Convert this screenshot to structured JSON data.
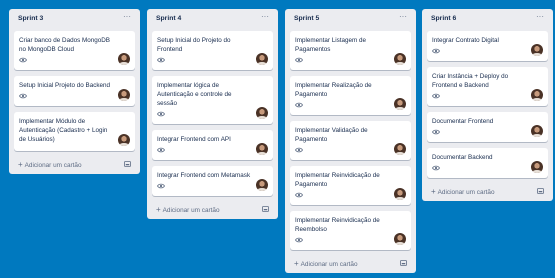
{
  "colors": {
    "board": "#0079bf",
    "list": "#ebecf0",
    "card": "#ffffff",
    "text": "#172b4d",
    "muted": "#5e6c84"
  },
  "lists": [
    {
      "title": "Sprint 3",
      "menu": "···",
      "add_label": "Adicionar um cartão",
      "cards": [
        {
          "title": "Criar banco de Dados MongoDB no MongoDB Cloud",
          "watch": true,
          "avatar": true
        },
        {
          "title": "Setup Inicial Projeto do Backend",
          "watch": true,
          "avatar": true
        },
        {
          "title": "Implementar Módulo de Autenticação (Cadastro + Login de Usuários)",
          "watch": false,
          "avatar": true
        }
      ]
    },
    {
      "title": "Sprint 4",
      "menu": "···",
      "add_label": "Adicionar um cartão",
      "cards": [
        {
          "title": "Setup Inicial do Projeto do Frontend",
          "watch": true,
          "avatar": true
        },
        {
          "title": "Implementar lógica de Autenticação e controle de sessão",
          "watch": true,
          "avatar": true
        },
        {
          "title": "Integrar Frontend com API",
          "watch": true,
          "avatar": true
        },
        {
          "title": "Integrar Frontend com Metamask",
          "watch": true,
          "avatar": true
        }
      ]
    },
    {
      "title": "Sprint 5",
      "menu": "···",
      "add_label": "Adicionar um cartão",
      "cards": [
        {
          "title": "Implementar Listagem de Pagamentos",
          "watch": true,
          "avatar": true
        },
        {
          "title": "Implementar Realização de Pagamento",
          "watch": true,
          "avatar": true
        },
        {
          "title": "Implementar Validação de Pagamento",
          "watch": true,
          "avatar": true
        },
        {
          "title": "Implementar Reinvidicação de Pagamento",
          "watch": true,
          "avatar": true
        },
        {
          "title": "Implementar Reinvidicação de Reembolso",
          "watch": true,
          "avatar": true
        }
      ]
    },
    {
      "title": "Sprint 6",
      "menu": "···",
      "add_label": "Adicionar um cartão",
      "cards": [
        {
          "title": "Integrar Contrato Digital",
          "watch": true,
          "avatar": true
        },
        {
          "title": "Criar Instância + Deploy do Frontend e Backend",
          "watch": true,
          "avatar": true
        },
        {
          "title": "Documentar Frontend",
          "watch": true,
          "avatar": true
        },
        {
          "title": "Documentar Backend",
          "watch": true,
          "avatar": true
        }
      ]
    }
  ]
}
